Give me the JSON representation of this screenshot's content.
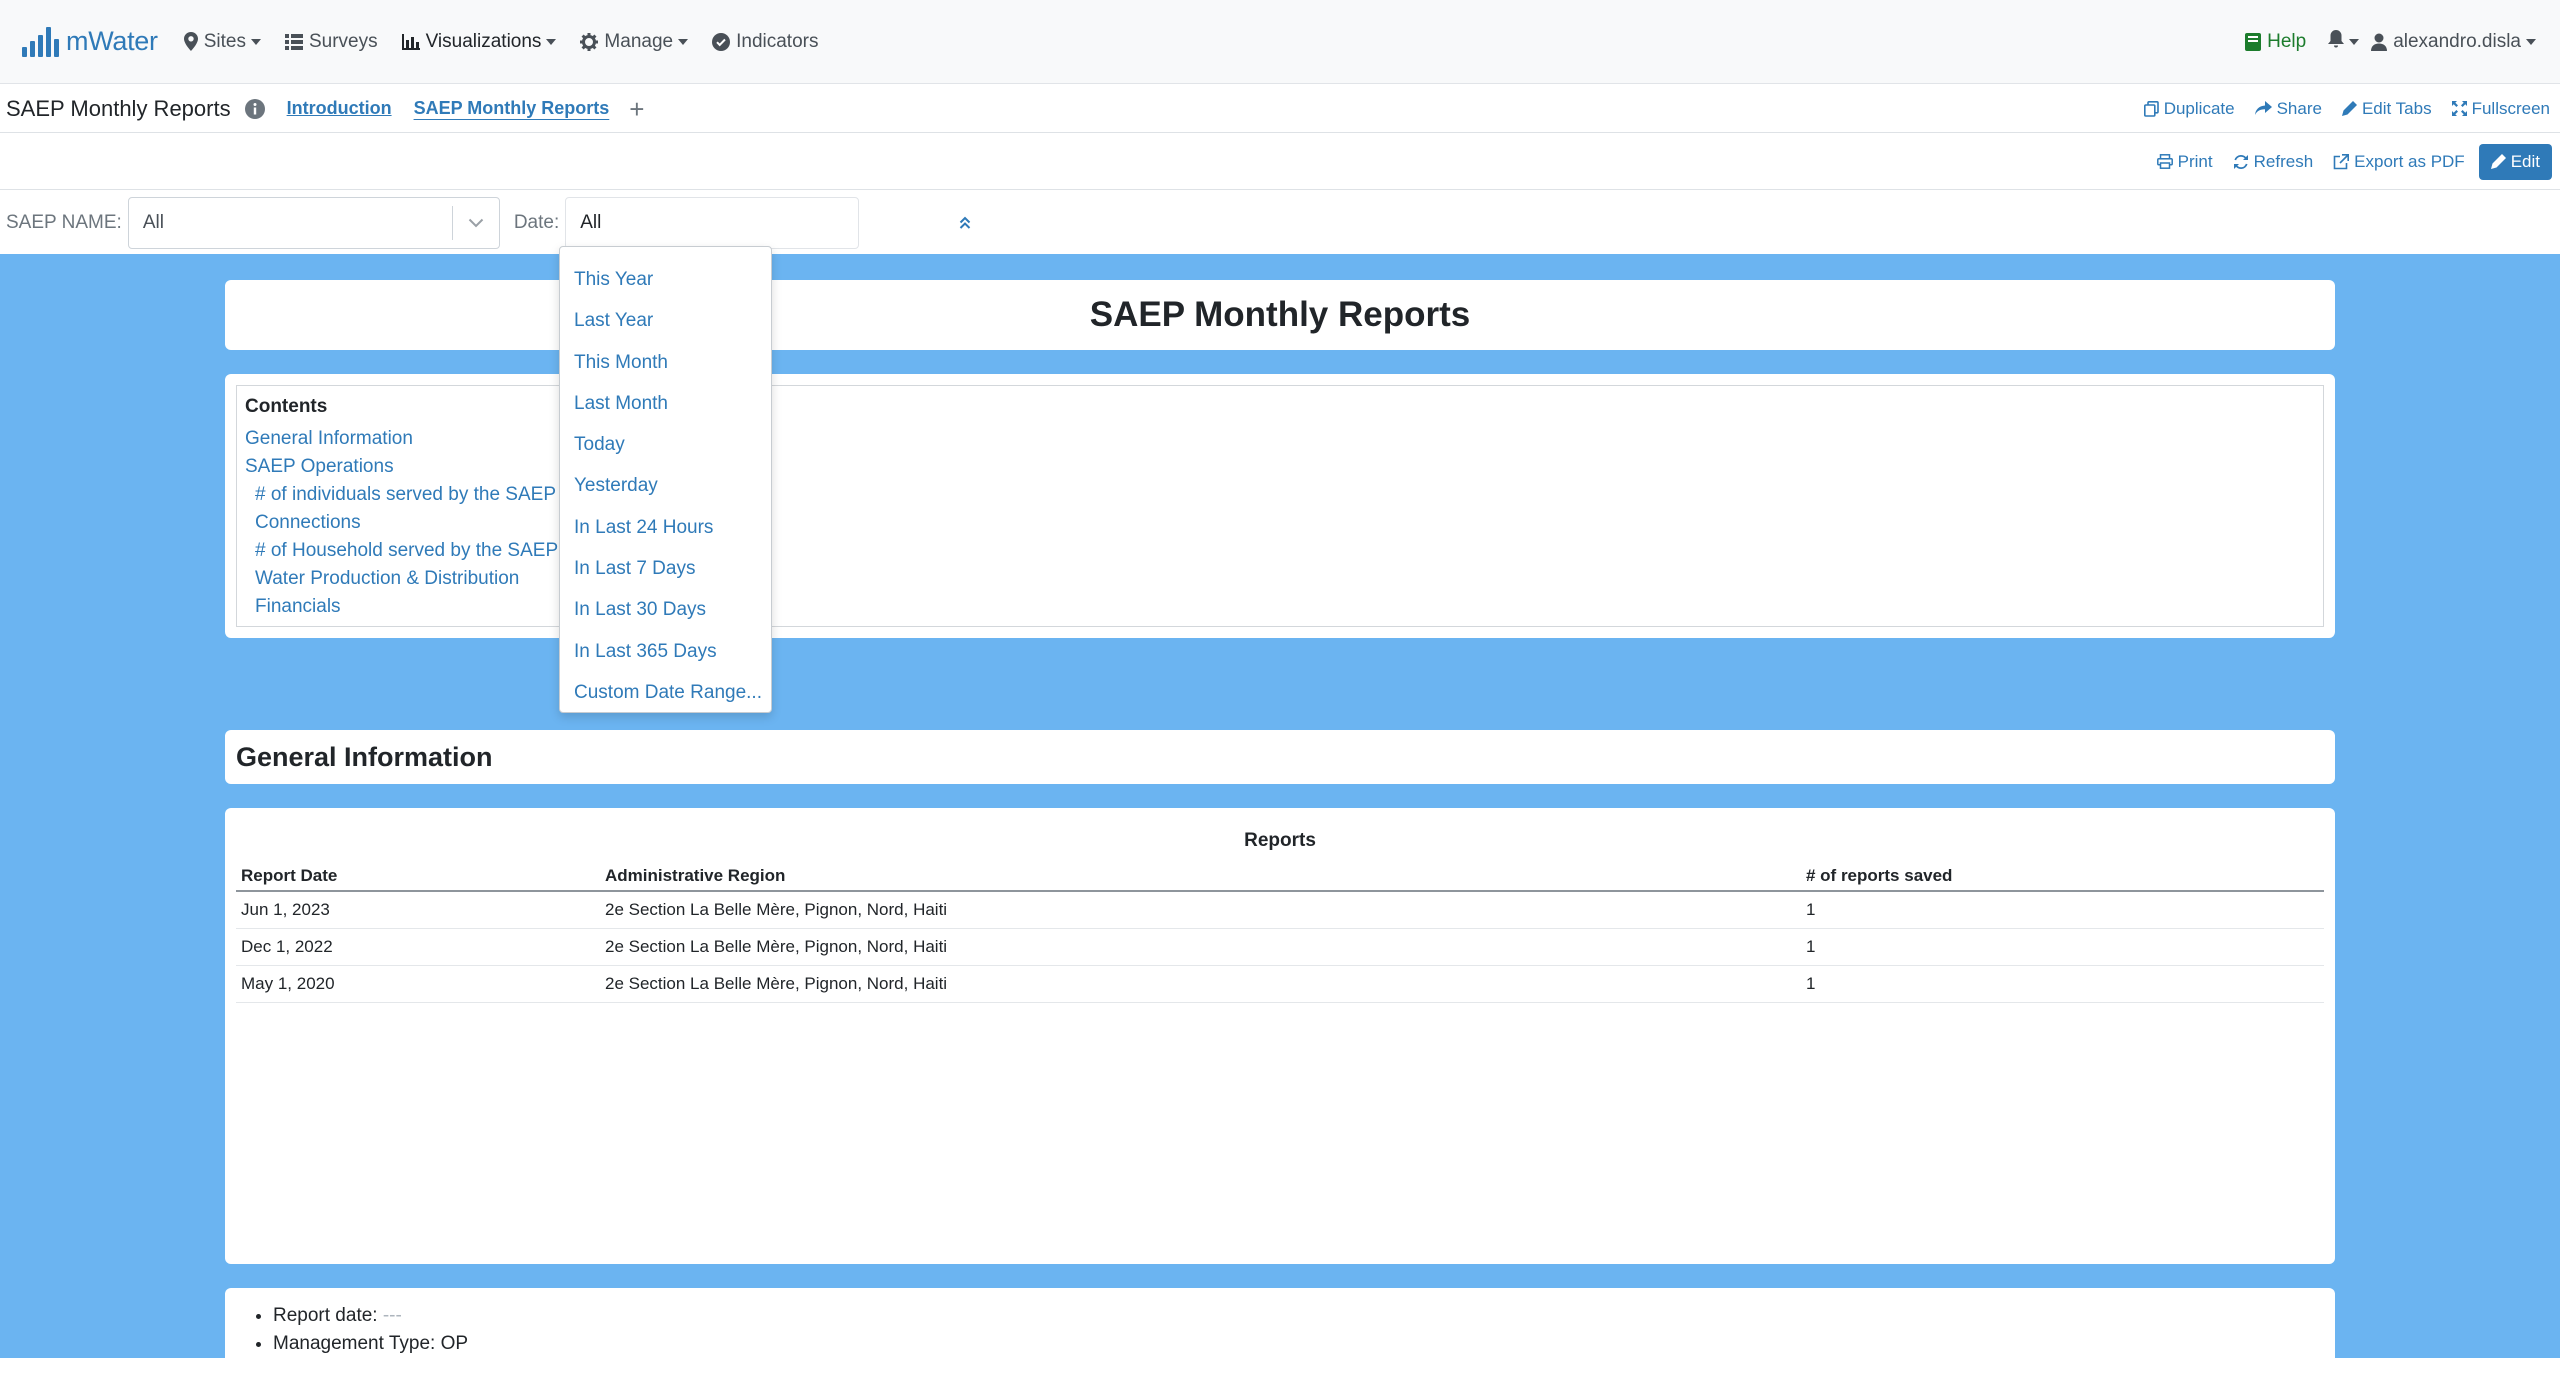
{
  "nav": {
    "brand": "mWater",
    "items": [
      {
        "label": "Sites",
        "icon": "map-marker-icon",
        "dropdown": true
      },
      {
        "label": "Surveys",
        "icon": "list-icon",
        "dropdown": false
      },
      {
        "label": "Visualizations",
        "icon": "bar-chart-icon",
        "dropdown": true
      },
      {
        "label": "Manage",
        "icon": "gear-icon",
        "dropdown": true
      },
      {
        "label": "Indicators",
        "icon": "check-circle-icon",
        "dropdown": false
      }
    ],
    "help": "Help",
    "user": "alexandro.disla"
  },
  "dashboard": {
    "title": "SAEP Monthly Reports",
    "tabs": [
      "Introduction",
      "SAEP Monthly Reports"
    ],
    "actions": [
      "Duplicate",
      "Share",
      "Edit Tabs",
      "Fullscreen"
    ]
  },
  "toolbar": {
    "print": "Print",
    "refresh": "Refresh",
    "export_pdf": "Export as PDF",
    "edit": "Edit"
  },
  "filters": {
    "saep_label": "SAEP NAME:",
    "saep_value": "All",
    "date_label": "Date:",
    "date_value": "All",
    "date_options": [
      "This Year",
      "Last Year",
      "This Month",
      "Last Month",
      "Today",
      "Yesterday",
      "In Last 24 Hours",
      "In Last 7 Days",
      "In Last 30 Days",
      "In Last 365 Days",
      "Custom Date Range..."
    ]
  },
  "report": {
    "title": "SAEP Monthly Reports",
    "contents": {
      "heading": "Contents",
      "items": [
        {
          "label": "General Information",
          "sub": false
        },
        {
          "label": "SAEP Operations",
          "sub": false
        },
        {
          "label": "# of individuals served by the SAEP",
          "sub": true
        },
        {
          "label": "Connections",
          "sub": true
        },
        {
          "label": "# of Household served by the SAEP",
          "sub": true
        },
        {
          "label": "Water Production & Distribution",
          "sub": true
        },
        {
          "label": "Financials",
          "sub": true
        }
      ]
    },
    "section_title": "General Information",
    "table": {
      "title": "Reports",
      "columns": [
        "Report Date",
        "Administrative Region",
        "# of reports saved"
      ],
      "rows": [
        [
          "Jun 1, 2023",
          "2e Section La Belle Mère, Pignon, Nord, Haiti",
          "1"
        ],
        [
          "Dec 1, 2022",
          "2e Section La Belle Mère, Pignon, Nord, Haiti",
          "1"
        ],
        [
          "May 1, 2020",
          "2e Section La Belle Mère, Pignon, Nord, Haiti",
          "1"
        ]
      ]
    },
    "details": [
      {
        "label": "Report date:",
        "value": "---"
      },
      {
        "label": "Management Type:",
        "value": "OP"
      }
    ]
  },
  "colors": {
    "accent": "#2f7ab8",
    "canvas": "#6bb4f1",
    "help": "#1c7c2c"
  }
}
